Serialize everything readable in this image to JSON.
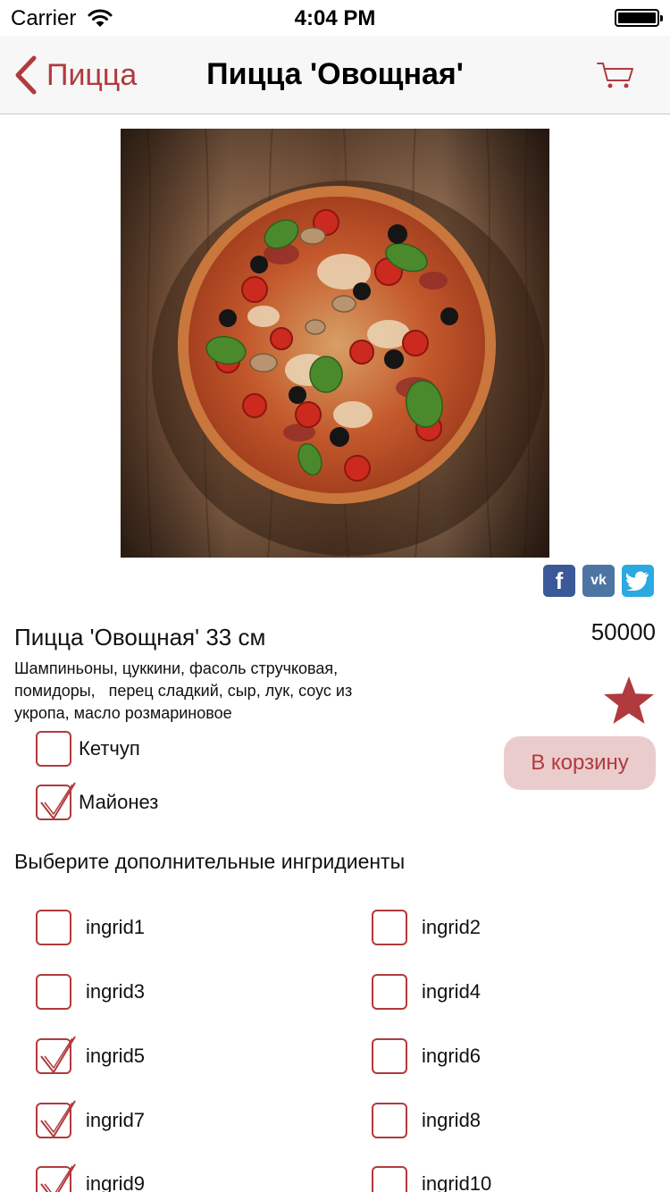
{
  "status_bar": {
    "carrier": "Carrier",
    "time": "4:04 PM"
  },
  "nav": {
    "back_label": "Пицца",
    "title": "Пицца 'Овощная'"
  },
  "product": {
    "name": "Пицца 'Овощная' 33 см",
    "price": "50000",
    "description": "Шампиньоны, цуккини, фасоль стручковая,\nпомидоры,   перец сладкий, сыр, лук, соус из\nукропа, масло розмариновое",
    "add_to_cart_label": "В корзину"
  },
  "sauces": [
    {
      "label": "Кетчуп",
      "checked": false
    },
    {
      "label": "Майонез",
      "checked": true
    }
  ],
  "ingredients_title": "Выберите дополнительные ингридиенты",
  "ingredients": [
    {
      "label": "ingrid1",
      "checked": false
    },
    {
      "label": "ingrid2",
      "checked": false
    },
    {
      "label": "ingrid3",
      "checked": false
    },
    {
      "label": "ingrid4",
      "checked": false
    },
    {
      "label": "ingrid5",
      "checked": true
    },
    {
      "label": "ingrid6",
      "checked": false
    },
    {
      "label": "ingrid7",
      "checked": true
    },
    {
      "label": "ingrid8",
      "checked": false
    },
    {
      "label": "ingrid9",
      "checked": true
    },
    {
      "label": "ingrid10",
      "checked": false
    }
  ],
  "social_icons": [
    "facebook-icon",
    "vk-icon",
    "twitter-icon"
  ],
  "colors": {
    "accent": "#b03a3e",
    "button_bg": "#ebcccc",
    "nav_bg": "#f7f7f7"
  }
}
